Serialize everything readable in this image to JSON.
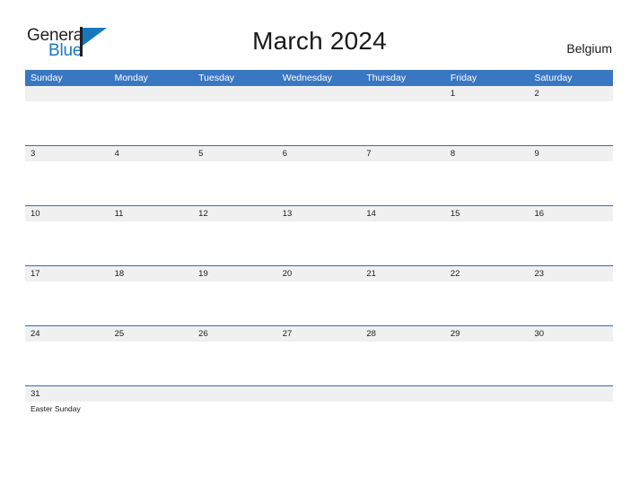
{
  "header": {
    "logo": {
      "word_one": "General",
      "word_two": "Blue"
    },
    "title": "March 2024",
    "country": "Belgium"
  },
  "colors": {
    "header_blue": "#3a77c2",
    "row_border_blue": "#2f6fb5",
    "date_band_gray": "#f0f0f0",
    "logo_blue": "#1878be",
    "text_dark": "#1a1a1a"
  },
  "calendar": {
    "weekday_headers": [
      "Sunday",
      "Monday",
      "Tuesday",
      "Wednesday",
      "Thursday",
      "Friday",
      "Saturday"
    ],
    "weeks": [
      {
        "dates": [
          "",
          "",
          "",
          "",
          "",
          "1",
          "2"
        ],
        "events": [
          [],
          [],
          [],
          [],
          [],
          [],
          []
        ]
      },
      {
        "dates": [
          "3",
          "4",
          "5",
          "6",
          "7",
          "8",
          "9"
        ],
        "events": [
          [],
          [],
          [],
          [],
          [],
          [],
          []
        ]
      },
      {
        "dates": [
          "10",
          "11",
          "12",
          "13",
          "14",
          "15",
          "16"
        ],
        "events": [
          [],
          [],
          [],
          [],
          [],
          [],
          []
        ]
      },
      {
        "dates": [
          "17",
          "18",
          "19",
          "20",
          "21",
          "22",
          "23"
        ],
        "events": [
          [],
          [],
          [],
          [],
          [],
          [],
          []
        ]
      },
      {
        "dates": [
          "24",
          "25",
          "26",
          "27",
          "28",
          "29",
          "30"
        ],
        "events": [
          [],
          [],
          [],
          [],
          [],
          [],
          []
        ]
      },
      {
        "dates": [
          "31",
          "",
          "",
          "",
          "",
          "",
          ""
        ],
        "events": [
          [
            "Easter Sunday"
          ],
          [],
          [],
          [],
          [],
          [],
          []
        ]
      }
    ]
  }
}
